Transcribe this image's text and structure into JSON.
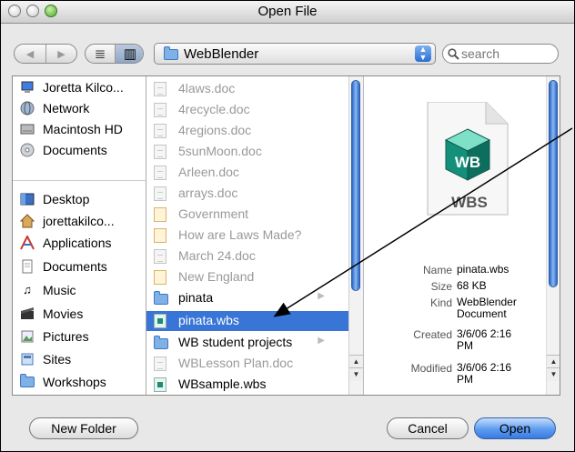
{
  "window": {
    "title": "Open File"
  },
  "toolbar": {
    "back_glyph": "◀",
    "forward_glyph": "▶",
    "list_view_glyph": "≣",
    "column_view_glyph": "▥",
    "location_label": "WebBlender",
    "search_placeholder": "search"
  },
  "sidebar": {
    "items": [
      {
        "label": "Joretta Kilco...",
        "icon": "computer-icon"
      },
      {
        "label": "Network",
        "icon": "network-globe-icon"
      },
      {
        "label": "Macintosh HD",
        "icon": "hard-drive-icon"
      },
      {
        "label": "Documents",
        "icon": "documents-disk-icon"
      },
      {
        "label": "Desktop",
        "icon": "desktop-icon"
      },
      {
        "label": "jorettakilco...",
        "icon": "home-icon"
      },
      {
        "label": "Applications",
        "icon": "applications-icon"
      },
      {
        "label": "Documents",
        "icon": "documents-folder-icon"
      },
      {
        "label": "Music",
        "icon": "music-icon"
      },
      {
        "label": "Movies",
        "icon": "movies-icon"
      },
      {
        "label": "Pictures",
        "icon": "pictures-icon"
      },
      {
        "label": "Sites",
        "icon": "sites-icon"
      },
      {
        "label": "Workshops",
        "icon": "folder-icon"
      }
    ]
  },
  "files": {
    "items": [
      {
        "name": "4laws.doc",
        "kind": "doc",
        "state": "dim"
      },
      {
        "name": "4recycle.doc",
        "kind": "doc",
        "state": "dim"
      },
      {
        "name": "4regions.doc",
        "kind": "doc",
        "state": "dim"
      },
      {
        "name": "5sunMoon.doc",
        "kind": "doc",
        "state": "dim"
      },
      {
        "name": "Arleen.doc",
        "kind": "doc",
        "state": "dim"
      },
      {
        "name": "arrays.doc",
        "kind": "doc",
        "state": "dim"
      },
      {
        "name": "Government",
        "kind": "page",
        "state": "dim"
      },
      {
        "name": "How are Laws Made?",
        "kind": "page",
        "state": "dim"
      },
      {
        "name": "March 24.doc",
        "kind": "doc",
        "state": "dim"
      },
      {
        "name": "New England",
        "kind": "page",
        "state": "dim"
      },
      {
        "name": "pinata",
        "kind": "folder",
        "state": "enabled"
      },
      {
        "name": "pinata.wbs",
        "kind": "wbs",
        "state": "selected"
      },
      {
        "name": "WB student projects",
        "kind": "folder",
        "state": "enabled"
      },
      {
        "name": "WBLesson Plan.doc",
        "kind": "doc",
        "state": "dim"
      },
      {
        "name": "WBsample.wbs",
        "kind": "wbs",
        "state": "enabled"
      }
    ]
  },
  "preview": {
    "icon_letters": "WB",
    "icon_caption": "WBS",
    "name_label": "Name",
    "name_value": "pinata.wbs",
    "size_label": "Size",
    "size_value": "68 KB",
    "kind_label": "Kind",
    "kind_value": "WebBlender Document",
    "created_label": "Created",
    "created_value": "3/6/06 2:16 PM",
    "modified_label": "Modified",
    "modified_value": "3/6/06 2:16 PM"
  },
  "buttons": {
    "new_folder_label": "New Folder",
    "cancel_label": "Cancel",
    "open_label": "Open"
  },
  "colors": {
    "selection": "#3875d7",
    "scroll_thumb": "#2a66c8",
    "annotation_arrow": "#000000"
  }
}
